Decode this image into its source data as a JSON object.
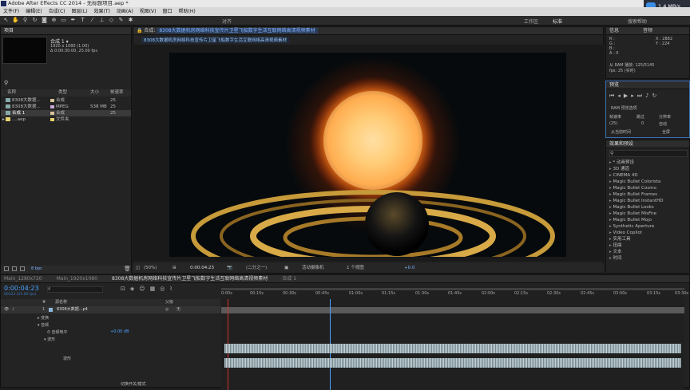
{
  "app": {
    "title": "Adobe After Effects CC 2014 - 无标题项目.aep *",
    "menus": [
      "文件(F)",
      "编辑(E)",
      "合成(C)",
      "图层(L)",
      "效果(T)",
      "动画(A)",
      "视图(V)",
      "窗口",
      "帮助(H)"
    ],
    "network_badge": "1.4 MB/s"
  },
  "toolbar": {
    "snap_label": "对齐",
    "workspace_label": "工作区",
    "workspace_value": "标准",
    "search_placeholder": "搜索帮助"
  },
  "project": {
    "tab_label": "项目",
    "comp_name": "合成 1 ▾",
    "comp_size": "1920 x 1080 (1.00)",
    "comp_duration": "Δ 0:00:30:00, 25.00 fps",
    "columns": [
      "名称",
      "类型",
      "大小",
      "帧速率"
    ],
    "items": [
      {
        "name": "8308大数据...",
        "type": "合成",
        "size": "",
        "fps": "25",
        "color": "#d7c49b"
      },
      {
        "name": "8308大数据...",
        "type": "MPEG",
        "size": "538 MB",
        "fps": "25",
        "color": "#c8a9d9"
      },
      {
        "name": "合成 1",
        "type": "合成",
        "size": "",
        "fps": "25",
        "color": "#d7c49b"
      },
      {
        "name": "....aep",
        "type": "文件夹",
        "size": "",
        "fps": "",
        "color": "#e8d36b"
      }
    ],
    "bpc": "8 bpc"
  },
  "composition": {
    "tab_label": "合成:",
    "tab_title": "8308大数据机房网络科技宣传片卫星飞船数字生活互联网络高清视频素材",
    "sub_tab": "8308大数据机房网络科技宣传片卫星飞船数字生活互联网络高清视频素材",
    "zoom": "(50%)",
    "timecode": "0:00:04:23",
    "resolution": "(二分之一)",
    "camera": "活动摄像机",
    "views": "1 个视图",
    "exposure": "+0.0"
  },
  "info_panel": {
    "tabs": [
      "信息",
      "音频"
    ],
    "rgba": [
      "R :",
      "G :",
      "B :",
      "A : 0"
    ],
    "coords": [
      "X : 2882",
      "Y : 224"
    ],
    "ram_text": "从 RAM 播放: 125/5145",
    "fps_text": "fps: 25 (实时)"
  },
  "preview_panel": {
    "tab": "预览",
    "ram_options": "RAM 预览选项",
    "frame_rate_label": "帧速率",
    "skip_label": "跳过",
    "resolution_label": "分辨率",
    "frame_rate_value": "(25)",
    "skip_value": "0",
    "resolution_value": "自动",
    "from_current": "从当前时间",
    "fullscreen": "全屏"
  },
  "effects_panel": {
    "tab": "效果和预设",
    "items": [
      "* 动画预设",
      "3D 通道",
      "CINEMA 4D",
      "Magic Bullet Colorista",
      "Magic Bullet Cosmo",
      "Magic Bullet Frames",
      "Magic Bullet InstantHD",
      "Magic Bullet Looks",
      "Magic Bullet MisFire",
      "Magic Bullet Mojo",
      "Synthetic Aperture",
      "Video Copilot",
      "实用工具",
      "扭曲",
      "文本",
      "时间"
    ]
  },
  "timeline": {
    "tabs": [
      "Main_1280x720",
      "Main_1920x1080",
      "8308大数据机房网络科技宣传片卫星飞船数字生活互联网络高清视频素材",
      "合成 1"
    ],
    "current_time": "0:00:04:23",
    "frame_info": "00123 (25.00 fps)",
    "columns": [
      "#",
      "源名称",
      "父级"
    ],
    "layer_number": "1",
    "layer_name": "8308大数据...p4",
    "parent_value": "无",
    "props": [
      "变换",
      "音频",
      "音频电平",
      "波形"
    ],
    "audio_level_value": "+0.00 dB",
    "waveform_label": "波形",
    "ruler": [
      "0:00s",
      "00:15s",
      "00:30s",
      "00:45s",
      "01:00s",
      "01:15s",
      "01:30s",
      "01:45s",
      "02:00s",
      "02:15s",
      "02:30s",
      "02:45s",
      "03:00s",
      "03:15s",
      "03:30s"
    ],
    "bottom_label": "切换开关/模式"
  }
}
